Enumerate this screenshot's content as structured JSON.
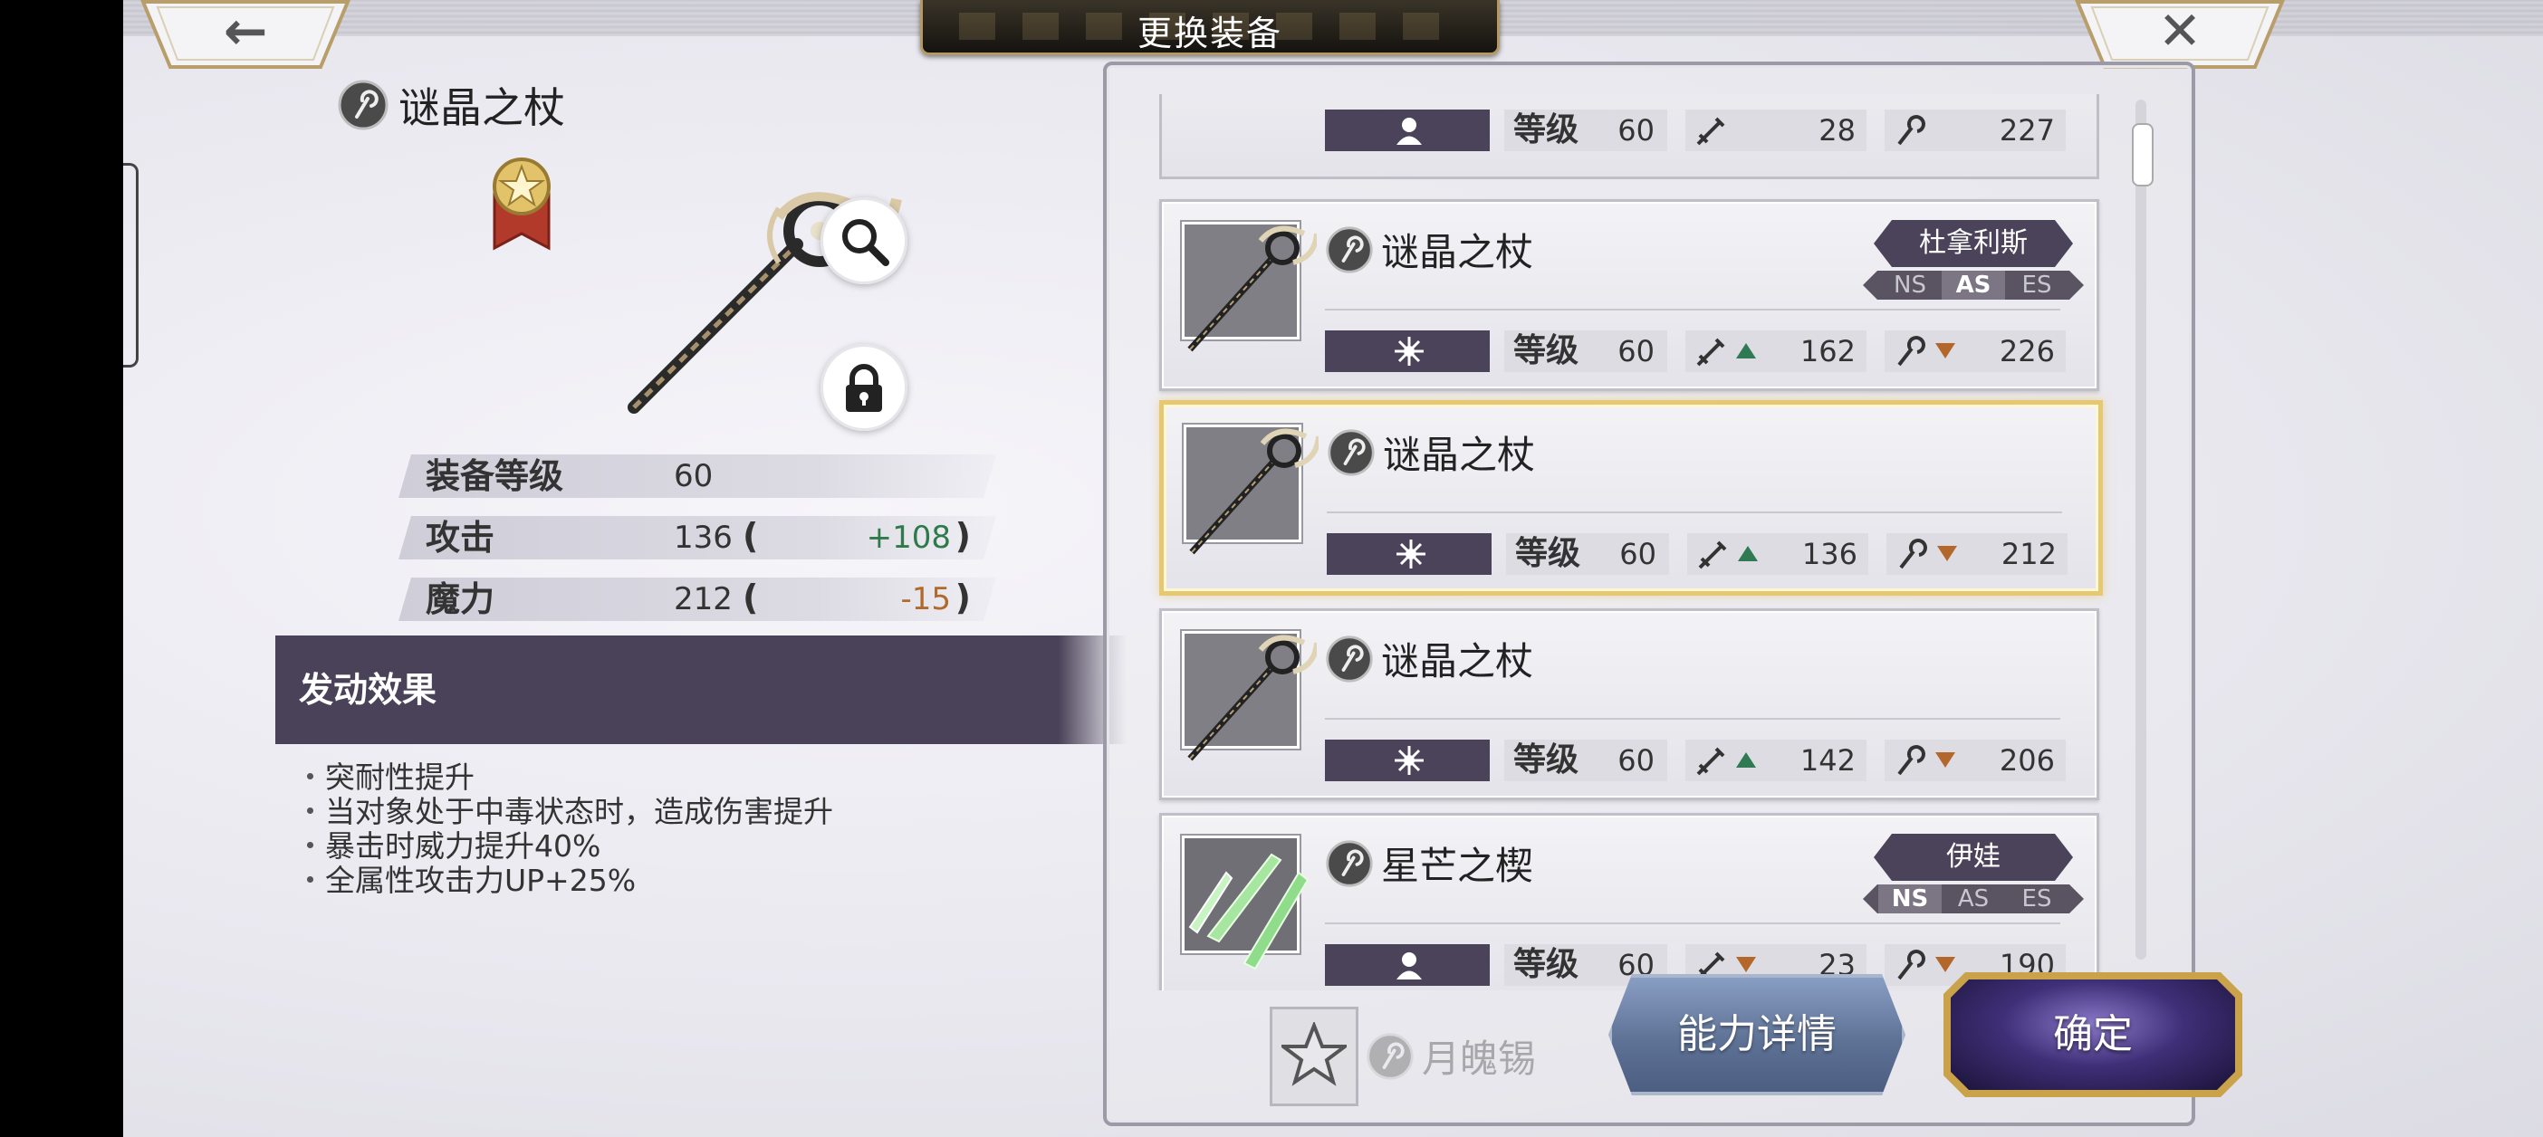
{
  "header": {
    "title": "更换装备",
    "back_icon": "back-arrow-icon",
    "close_icon": "close-icon"
  },
  "detail": {
    "name": "谜晶之杖",
    "type_icon": "staff-type-icon",
    "rank_icon": "star-rank-badge-icon",
    "stats": [
      {
        "label": "装备等级",
        "value": "60",
        "diff": ""
      },
      {
        "label": "攻击",
        "value": "136",
        "diff": "+108",
        "trend": "up"
      },
      {
        "label": "魔力",
        "value": "212",
        "diff": "-15",
        "trend": "down"
      }
    ],
    "effect_title": "发动效果",
    "effects": [
      "突耐性提升",
      "当对象处于中毒状态时，造成伤害提升",
      "暴击时威力提升40%",
      "全属性攻击力UP+25%"
    ]
  },
  "list": {
    "items": [
      {
        "name": "",
        "level_label": "等级",
        "level": "60",
        "atk": "28",
        "mag": "227",
        "slot": "person",
        "partial": true
      },
      {
        "name": "谜晶之杖",
        "level_label": "等级",
        "level": "60",
        "atk": "162",
        "atk_trend": "up",
        "mag": "226",
        "mag_trend": "down",
        "slot": "spark",
        "owner": "杜拿利斯",
        "tags": [
          "NS",
          "AS",
          "ES"
        ],
        "active_tag": "AS"
      },
      {
        "name": "谜晶之杖",
        "level_label": "等级",
        "level": "60",
        "atk": "136",
        "atk_trend": "up",
        "mag": "212",
        "mag_trend": "down",
        "slot": "spark",
        "selected": true
      },
      {
        "name": "谜晶之杖",
        "level_label": "等级",
        "level": "60",
        "atk": "142",
        "atk_trend": "up",
        "mag": "206",
        "mag_trend": "down",
        "slot": "spark"
      },
      {
        "name": "星芒之楔",
        "level_label": "等级",
        "level": "60",
        "atk": "23",
        "atk_trend": "down",
        "mag": "190",
        "mag_trend": "down",
        "slot": "person",
        "owner": "伊娃",
        "tags": [
          "NS",
          "AS",
          "ES"
        ],
        "active_tag": "NS"
      }
    ],
    "ghost_item_name": "月魄锡"
  },
  "buttons": {
    "detail": "能力详情",
    "confirm": "确定",
    "favorite_icon": "star-outline-icon"
  },
  "colors": {
    "accent_gold": "#e6c772",
    "slot_purple": "#4b4359",
    "up_green": "#2f7a52",
    "down_orange": "#b3672a"
  }
}
